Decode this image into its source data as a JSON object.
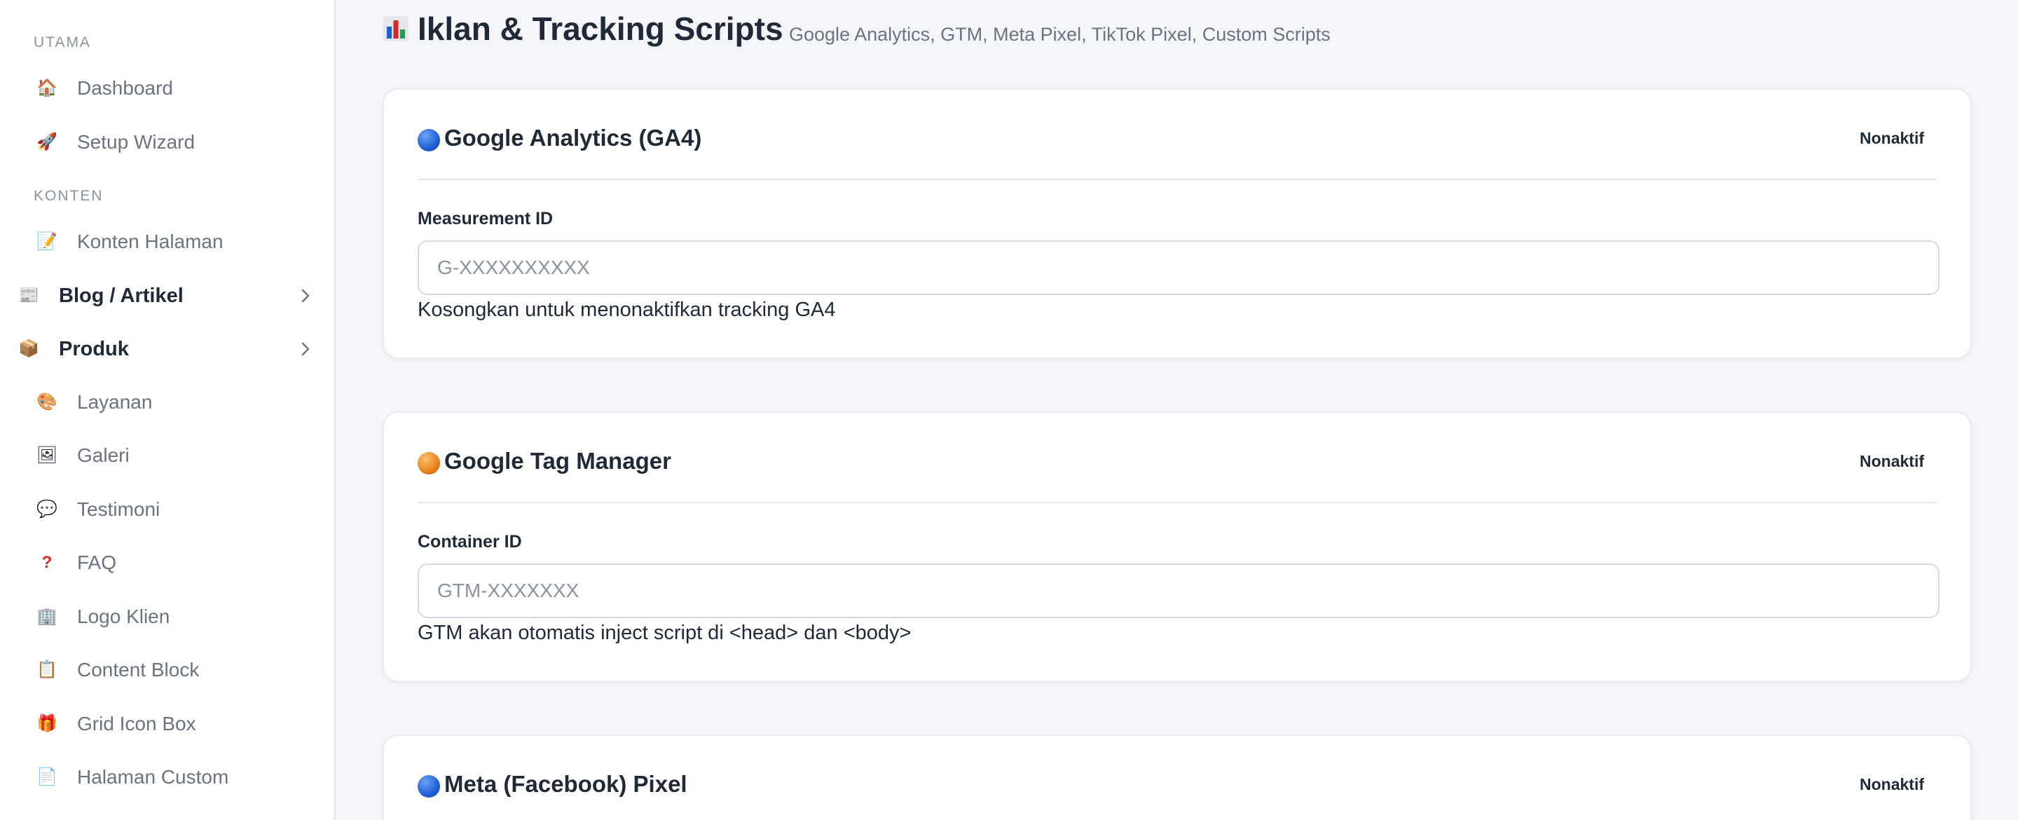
{
  "sidebar": {
    "section_utama": "UTAMA",
    "section_konten": "KONTEN",
    "items": [
      {
        "label": "Dashboard",
        "icon": "house-icon"
      },
      {
        "label": "Setup Wizard",
        "icon": "rocket-icon"
      },
      {
        "label": "Konten Halaman",
        "icon": "memo-icon"
      },
      {
        "label": "Blog / Artikel",
        "icon": "newspaper-icon"
      },
      {
        "label": "Produk",
        "icon": "package-icon"
      },
      {
        "label": "Layanan",
        "icon": "palette-icon"
      },
      {
        "label": "Galeri",
        "icon": "picture-icon"
      },
      {
        "label": "Testimoni",
        "icon": "speech-bubble-icon"
      },
      {
        "label": "FAQ",
        "icon": "question-mark-icon"
      },
      {
        "label": "Logo Klien",
        "icon": "office-building-icon"
      },
      {
        "label": "Content Block",
        "icon": "clipboard-icon"
      },
      {
        "label": "Grid Icon Box",
        "icon": "gift-icon"
      },
      {
        "label": "Halaman Custom",
        "icon": "page-icon"
      }
    ]
  },
  "header": {
    "title": "Iklan & Tracking Scripts",
    "subtitle": "Google Analytics, GTM, Meta Pixel, TikTok Pixel, Custom Scripts"
  },
  "cards": [
    {
      "title": "Google Analytics (GA4)",
      "status": "Nonaktif",
      "dot_color": "#1f5fd6",
      "field_label": "Measurement ID",
      "placeholder": "G-XXXXXXXXXX",
      "value": "",
      "help": "Kosongkan untuk menonaktifkan tracking GA4"
    },
    {
      "title": "Google Tag Manager",
      "status": "Nonaktif",
      "dot_color": "#e8821c",
      "field_label": "Container ID",
      "placeholder": "GTM-XXXXXXX",
      "value": "",
      "help": "GTM akan otomatis inject script di <head> dan <body>"
    },
    {
      "title": "Meta (Facebook) Pixel",
      "status": "Nonaktif",
      "dot_color": "#1f5fd6"
    }
  ]
}
